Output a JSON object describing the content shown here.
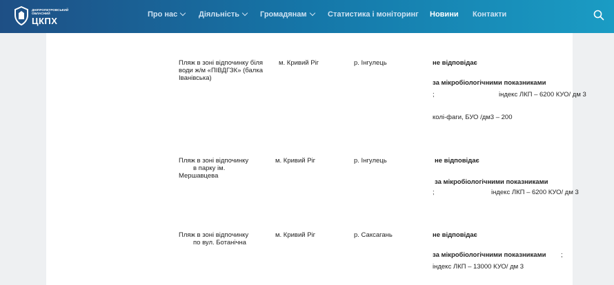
{
  "header": {
    "logo_small": "Дніпропетровський обласний",
    "logo_big": "ЦКПХ",
    "nav": [
      {
        "label": "Про нас",
        "dropdown": true
      },
      {
        "label": "Діяльність",
        "dropdown": true
      },
      {
        "label": "Громадянам",
        "dropdown": true
      },
      {
        "label": "Статистика і моніторинг",
        "dropdown": false
      },
      {
        "label": "Новини",
        "dropdown": false,
        "active": true
      },
      {
        "label": "Контакти",
        "dropdown": false
      }
    ],
    "search_icon": "search-icon"
  },
  "rows": [
    {
      "place": [
        "Пляж в зоні відпочинку біля",
        "води ж/м «ПІВДГЗК» (балка",
        "Іванівська)"
      ],
      "city": "м. Кривий Ріг",
      "river": "р. Інгулець",
      "verdict": "не відповідає",
      "criteria": "за мікробіологічними показниками",
      "semicolon": ";",
      "index": "індекс ЛКП   –   6200 КУО/ дм 3",
      "phage": "колі-фаги, БУО /дм3   – 200"
    },
    {
      "place": [
        "Пляж в зоні відпочинку",
        "в парку ім.",
        "Мершавцева"
      ],
      "city": "м. Кривий Ріг",
      "river": "р. Інгулець",
      "verdict": "не відповідає",
      "criteria": "за мікробіологічними показниками",
      "semicolon": ";",
      "index": "індекс ЛКП   –   6200 КУО/ дм 3"
    },
    {
      "place": [
        "Пляж в зоні відпочинку",
        "по вул. Ботанічна"
      ],
      "city": "м. Кривий Ріг",
      "river": "р. Саксагань",
      "verdict": "не відповідає",
      "criteria": "за мікробіологічними показниками",
      "semicolon": " ;",
      "index": "індекс ЛКП   –   13000 КУО/ дм 3"
    }
  ],
  "colors": {
    "header_start": "#1e4f85",
    "header_end": "#1a9cc4",
    "page_bg": "#eef0f2"
  }
}
